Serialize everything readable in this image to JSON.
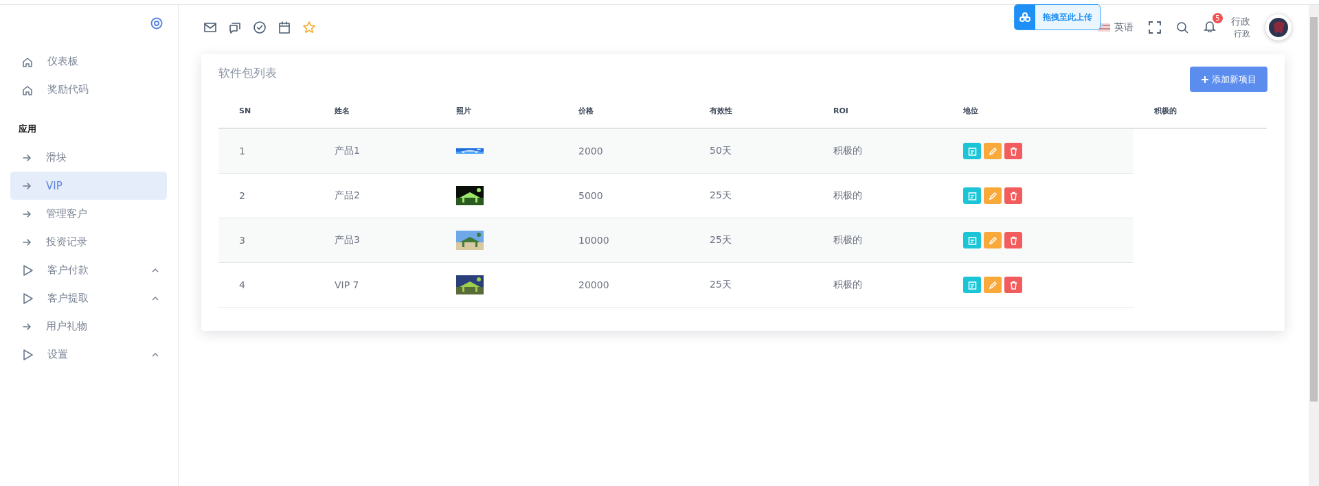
{
  "sidebar": {
    "items": [
      {
        "label": "仪表板",
        "selected": false
      },
      {
        "label": "奖励代码",
        "selected": false
      }
    ],
    "section": "应用",
    "app_items": [
      {
        "label": "滑块",
        "kind": "link",
        "selected": false
      },
      {
        "label": "VIP",
        "kind": "link",
        "selected": true
      },
      {
        "label": "管理客户",
        "kind": "link",
        "selected": false
      },
      {
        "label": "投资记录",
        "kind": "link",
        "selected": false
      },
      {
        "label": "客户付款",
        "kind": "group",
        "selected": false
      },
      {
        "label": "客户提取",
        "kind": "group",
        "selected": false
      },
      {
        "label": "用户礼物",
        "kind": "link",
        "selected": false
      },
      {
        "label": "设置",
        "kind": "group",
        "selected": false
      }
    ]
  },
  "topbar": {
    "language": "英语",
    "notifications": "5",
    "user_name": "行政",
    "user_role": "行政"
  },
  "upload_overlay": {
    "label": "拖拽至此上传"
  },
  "card": {
    "title": "软件包列表",
    "add_button": "添加新项目",
    "columns": [
      "SN",
      "姓名",
      "照片",
      "价格",
      "有效性",
      "ROI",
      "地位",
      "积极的"
    ],
    "rows": [
      {
        "sn": "1",
        "name": "产品1",
        "price": "2000",
        "validity": "50天",
        "roi": "积极的"
      },
      {
        "sn": "2",
        "name": "产品2",
        "price": "5000",
        "validity": "25天",
        "roi": "积极的"
      },
      {
        "sn": "3",
        "name": "产品3",
        "price": "10000",
        "validity": "25天",
        "roi": "积极的"
      },
      {
        "sn": "4",
        "name": "VIP 7",
        "price": "20000",
        "validity": "25天",
        "roi": "积极的"
      }
    ]
  }
}
